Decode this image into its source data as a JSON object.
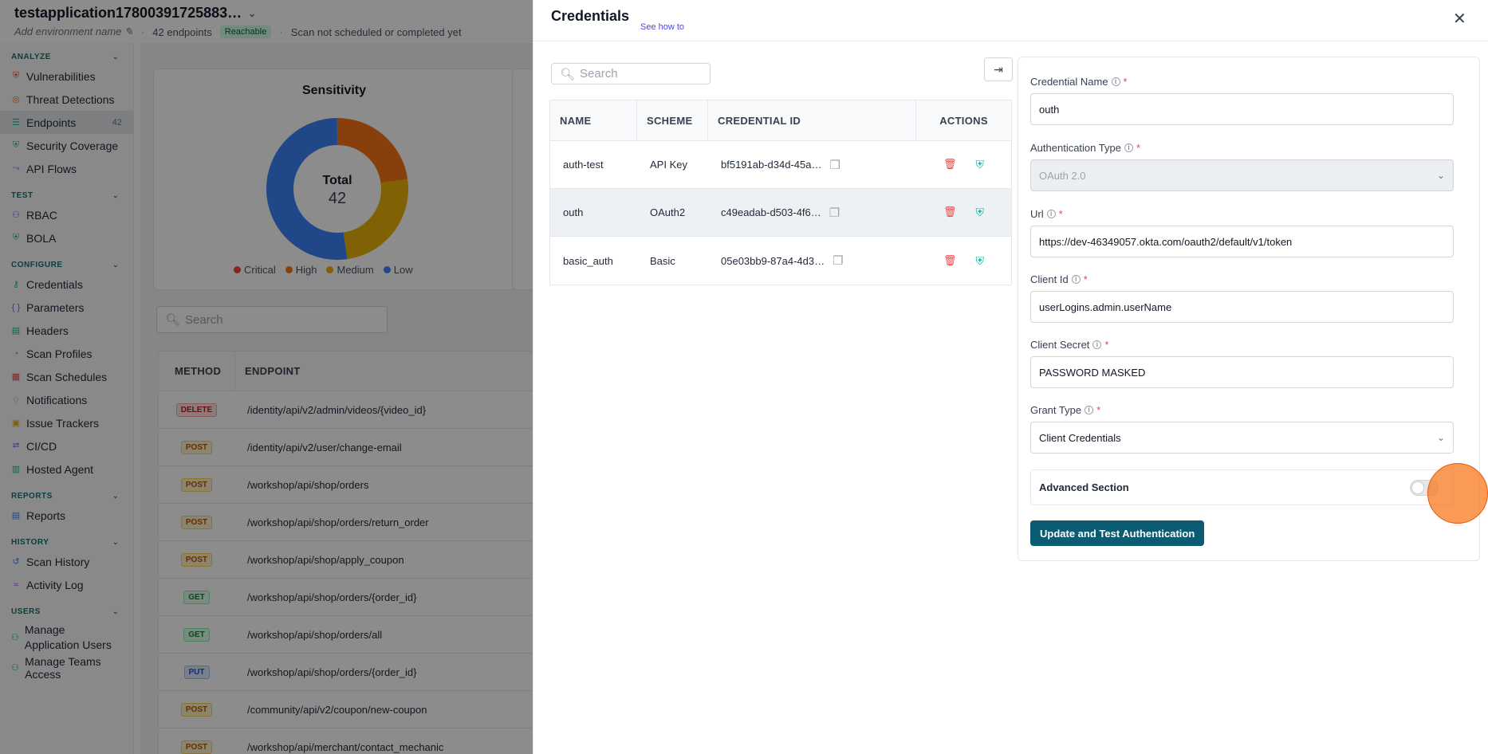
{
  "app": {
    "title": "testapplication17800391725883…",
    "env_placeholder": "Add environment name",
    "endpoints_count": "42 endpoints",
    "reach_badge": "Reachable",
    "scan_status": "Scan not scheduled or completed yet"
  },
  "sidebar": {
    "sections": [
      {
        "title": "ANALYZE",
        "items": [
          {
            "label": "Vulnerabilities",
            "icon": "shield-alert-icon",
            "color": "#ef4444"
          },
          {
            "label": "Threat Detections",
            "icon": "target-icon",
            "color": "#f97316"
          },
          {
            "label": "Endpoints",
            "icon": "list-icon",
            "color": "#14b8a6",
            "count": "42",
            "active": true
          },
          {
            "label": "Security Coverage",
            "icon": "shield-check-icon",
            "color": "#22c55e"
          },
          {
            "label": "API Flows",
            "icon": "flow-icon",
            "color": "#6366f1"
          }
        ]
      },
      {
        "title": "TEST",
        "items": [
          {
            "label": "RBAC",
            "icon": "users-icon",
            "color": "#a855f7"
          },
          {
            "label": "BOLA",
            "icon": "shield-check-icon",
            "color": "#22c55e"
          }
        ]
      },
      {
        "title": "CONFIGURE",
        "items": [
          {
            "label": "Credentials",
            "icon": "key-icon",
            "color": "#14b8a6"
          },
          {
            "label": "Parameters",
            "icon": "braces-icon",
            "color": "#8b5cf6"
          },
          {
            "label": "Headers",
            "icon": "headers-icon",
            "color": "#10b981"
          },
          {
            "label": "Scan Profiles",
            "icon": "gauge-icon",
            "color": "#f97316"
          },
          {
            "label": "Scan Schedules",
            "icon": "calendar-icon",
            "color": "#ef4444"
          },
          {
            "label": "Notifications",
            "icon": "bell-icon",
            "color": "#6366f1"
          },
          {
            "label": "Issue Trackers",
            "icon": "tracker-icon",
            "color": "#eab308"
          },
          {
            "label": "CI/CD",
            "icon": "pipeline-icon",
            "color": "#a855f7"
          },
          {
            "label": "Hosted Agent",
            "icon": "server-icon",
            "color": "#14b8a6"
          }
        ]
      },
      {
        "title": "REPORTS",
        "items": [
          {
            "label": "Reports",
            "icon": "document-icon",
            "color": "#3b82f6"
          }
        ]
      },
      {
        "title": "HISTORY",
        "items": [
          {
            "label": "Scan History",
            "icon": "history-icon",
            "color": "#3b82f6"
          },
          {
            "label": "Activity Log",
            "icon": "activity-icon",
            "color": "#a855f7"
          }
        ]
      },
      {
        "title": "USERS",
        "items": [
          {
            "label": "Manage Application Users",
            "icon": "users-icon",
            "color": "#14b8a6"
          },
          {
            "label": "Manage Teams Access",
            "icon": "team-icon",
            "color": "#22c55e"
          }
        ]
      }
    ]
  },
  "sensitivity": {
    "title": "Sensitivity",
    "total_label": "Total",
    "total_value": "42",
    "legend": [
      {
        "label": "Critical",
        "color": "#ef4444"
      },
      {
        "label": "High",
        "color": "#f97316"
      },
      {
        "label": "Medium",
        "color": "#eab308"
      },
      {
        "label": "Low",
        "color": "#3b82f6"
      }
    ]
  },
  "endpoints_search_placeholder": "Search",
  "endpoints_table": {
    "headers": [
      "METHOD",
      "ENDPOINT"
    ],
    "rows": [
      {
        "method": "DELETE",
        "path": "/identity/api/v2/admin/videos/{video_id}"
      },
      {
        "method": "POST",
        "path": "/identity/api/v2/user/change-email"
      },
      {
        "method": "POST",
        "path": "/workshop/api/shop/orders"
      },
      {
        "method": "POST",
        "path": "/workshop/api/shop/orders/return_order"
      },
      {
        "method": "POST",
        "path": "/workshop/api/shop/apply_coupon"
      },
      {
        "method": "GET",
        "path": "/workshop/api/shop/orders/{order_id}"
      },
      {
        "method": "GET",
        "path": "/workshop/api/shop/orders/all"
      },
      {
        "method": "PUT",
        "path": "/workshop/api/shop/orders/{order_id}"
      },
      {
        "method": "POST",
        "path": "/community/api/v2/coupon/new-coupon"
      },
      {
        "method": "POST",
        "path": "/workshop/api/merchant/contact_mechanic"
      }
    ]
  },
  "drawer": {
    "title": "Credentials",
    "see_how": "See how to",
    "search_placeholder": "Search",
    "table": {
      "headers": [
        "NAME",
        "SCHEME",
        "CREDENTIAL ID",
        "ACTIONS"
      ],
      "rows": [
        {
          "name": "auth-test",
          "scheme": "API Key",
          "id": "bf5191ab-d34d-45a…"
        },
        {
          "name": "outh",
          "scheme": "OAuth2",
          "id": "c49eadab-d503-4f6…"
        },
        {
          "name": "basic_auth",
          "scheme": "Basic",
          "id": "05e03bb9-87a4-4d3…"
        }
      ]
    },
    "form": {
      "credential_name": {
        "label": "Credential Name",
        "value": "outh"
      },
      "auth_type": {
        "label": "Authentication Type",
        "value": "OAuth 2.0"
      },
      "url": {
        "label": "Url",
        "value": "https://dev-46349057.okta.com/oauth2/default/v1/token"
      },
      "client_id": {
        "label": "Client Id",
        "value": "userLogins.admin.userName"
      },
      "client_secret": {
        "label": "Client Secret",
        "value": "PASSWORD MASKED"
      },
      "grant_type": {
        "label": "Grant Type",
        "value": "Client Credentials"
      },
      "advanced_label": "Advanced Section",
      "advanced_enabled": false,
      "submit_label": "Update and Test Authentication"
    }
  },
  "colors": {
    "accent": "#0b5c73",
    "required": "#ef4444",
    "link": "#4f46e5"
  }
}
